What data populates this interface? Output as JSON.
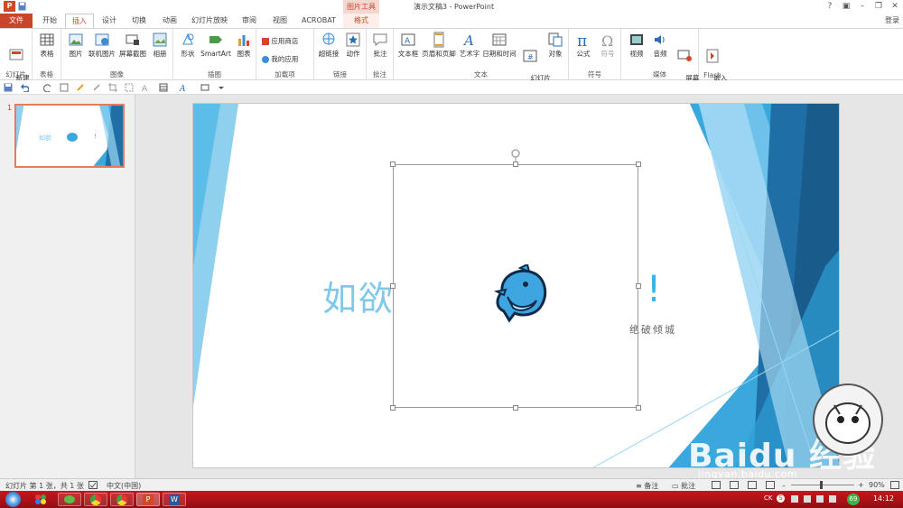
{
  "window": {
    "title": "演示文稿3 - PowerPoint",
    "context_tool": "图片工具",
    "help": "?",
    "login": "登录"
  },
  "tabs": [
    {
      "label": "文件"
    },
    {
      "label": "开始"
    },
    {
      "label": "插入"
    },
    {
      "label": "设计"
    },
    {
      "label": "切换"
    },
    {
      "label": "动画"
    },
    {
      "label": "幻灯片放映"
    },
    {
      "label": "审阅"
    },
    {
      "label": "视图"
    },
    {
      "label": "ACROBAT"
    },
    {
      "label": "格式"
    }
  ],
  "ribbon": {
    "groups": {
      "slides": "幻灯片",
      "tables": "表格",
      "images": "图像",
      "illustrations": "插图",
      "addins": "加载项",
      "links": "链接",
      "comments": "批注",
      "text": "文本",
      "symbols": "符号",
      "media": "媒体",
      "flash": "Flash"
    },
    "buttons": {
      "new_slide": "新建\n幻灯片",
      "table": "表格",
      "picture": "图片",
      "online_picture": "联机图片",
      "screenshot": "屏幕截图",
      "album": "相册",
      "shapes": "形状",
      "smartart": "SmartArt",
      "chart": "图表",
      "app_store": "应用商店",
      "my_apps": "我的应用",
      "hyperlink": "超链接",
      "action": "动作",
      "comment": "批注",
      "textbox": "文本框",
      "header_footer": "页眉和页脚",
      "wordart": "艺术字",
      "date_time": "日期和时间",
      "slide_number": "幻灯片\n编号",
      "object": "对象",
      "equation": "公式",
      "symbol": "符号",
      "video": "视频",
      "audio": "音频",
      "screen_record": "屏幕\n录制",
      "embed_flash": "嵌入\nFlash"
    }
  },
  "thumbnails": [
    {
      "number": "1",
      "title": "如欲",
      "excl": "!"
    }
  ],
  "slide": {
    "title_left": "如欲",
    "excl": "!",
    "subtitle": "绝破倾城"
  },
  "status": {
    "slide_info": "幻灯片 第 1 张，共 1 张",
    "language": "中文(中国)",
    "notes": "备注",
    "comments": "批注",
    "zoom": "90%"
  },
  "taskbar": {
    "clock": "14:12",
    "ime": "CK",
    "battery": "69"
  },
  "watermark": {
    "brand": "Baidu 经验",
    "url": "jingyan.baidu.com"
  },
  "colors": {
    "accent": "#c8462c",
    "slide_blue": "#2aa3e0",
    "slide_light_blue": "#7ec8ec"
  }
}
